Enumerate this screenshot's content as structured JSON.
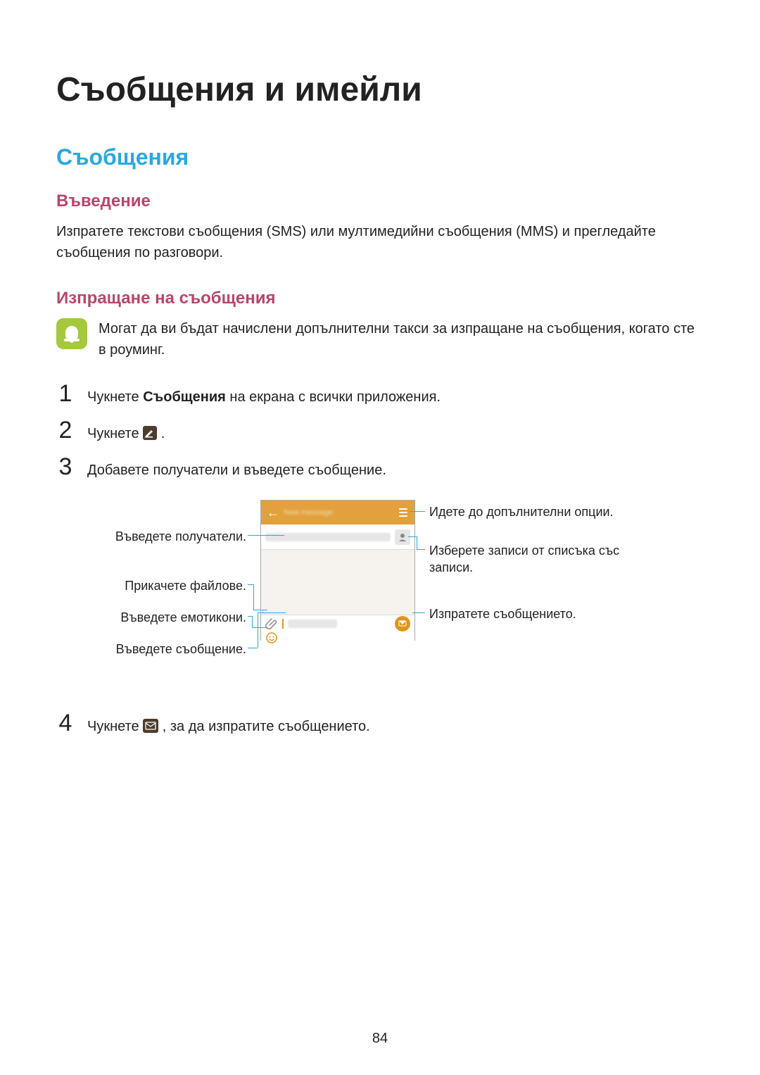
{
  "headings": {
    "h1": "Съобщения и имейли",
    "h2": "Съобщения",
    "h3_intro": "Въведение",
    "h3_sending": "Изпращане на съобщения"
  },
  "intro_para": "Изпратете текстови съобщения (SMS) или мултимедийни съобщения (MMS) и прегледайте съобщения по разговори.",
  "note_text": "Могат да ви бъдат начислени допълнителни такси за изпращане на съобщения, когато сте в роуминг.",
  "steps": {
    "s1_pre": "Чукнете ",
    "s1_bold": "Съобщения",
    "s1_post": " на екрана с всички приложения.",
    "s2_pre": "Чукнете ",
    "s2_post": ".",
    "s3": "Добавете получатели и въведете съобщение.",
    "s4_pre": "Чукнете ",
    "s4_post": ", за да изпратите съобщението."
  },
  "callouts": {
    "more_options": "Идете до допълнителни опции.",
    "enter_recipients": "Въведете получатели.",
    "select_contacts_l1": "Изберете записи от списъка със",
    "select_contacts_l2": "записи.",
    "attach_files": "Прикачете файлове.",
    "send_message": "Изпратете съобщението.",
    "enter_emoticons": "Въведете емотикони.",
    "enter_message": "Въведете съобщение."
  },
  "phone_ui": {
    "title_placeholder": "New message",
    "recipient_placeholder": "Enter recipients",
    "message_placeholder": "Enter message"
  },
  "colors": {
    "accent_blue": "#2aa8e0",
    "accent_pink": "#b84668",
    "orange": "#e0941e",
    "note_green": "#a5c83c"
  },
  "page_number": "84"
}
